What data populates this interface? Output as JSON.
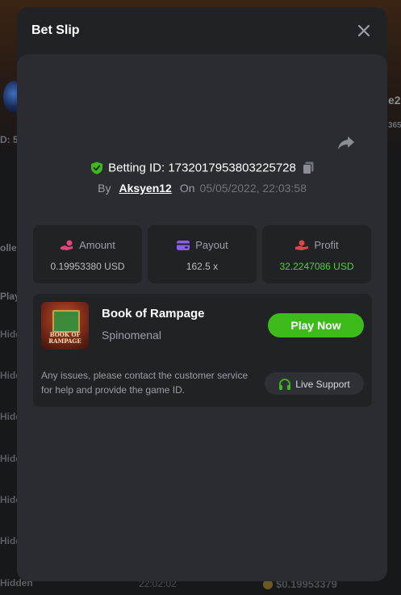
{
  "background": {
    "side_fragments": [
      "D: 5",
      "olle",
      "Play"
    ],
    "right_fragments": [
      "e2",
      "365"
    ],
    "hidden_rows": [
      "Hidd",
      "Hidd",
      "Hidd",
      "Hidd",
      "Hidd",
      "Hidd",
      "Hidden"
    ],
    "bottom_time": "22:02:02",
    "bottom_amount": "$0.19953379"
  },
  "modal": {
    "title": "Bet Slip",
    "close_icon": "close-icon",
    "share_icon": "share-icon"
  },
  "bet": {
    "id_label": "Betting ID: 1732017953803225728",
    "by_label": "By",
    "user": "Aksyen12",
    "on_label": "On",
    "date": "05/05/2022, 22:03:58"
  },
  "stats": {
    "amount": {
      "label": "Amount",
      "value": "0.19953380 USD",
      "icon": "coins-hand-icon",
      "color": "#e0457b"
    },
    "payout": {
      "label": "Payout",
      "value": "162.5 x",
      "icon": "wallet-icon",
      "color": "#8b5cf6"
    },
    "profit": {
      "label": "Profit",
      "value": "32.2247086 USD",
      "icon": "money-hand-icon",
      "color": "#e0454a"
    }
  },
  "game": {
    "thumb_text": "BOOK OF RAMPAGE",
    "name": "Book of Rampage",
    "provider": "Spinomenal",
    "play_label": "Play Now",
    "issues_text": "Any issues, please contact the customer service for help and provide the game ID.",
    "support_label": "Live Support"
  },
  "colors": {
    "accent_green": "#3dbb1a",
    "profit_green": "#4fd13a",
    "modal_bg": "#202226",
    "card_bg": "#2a2c31"
  }
}
